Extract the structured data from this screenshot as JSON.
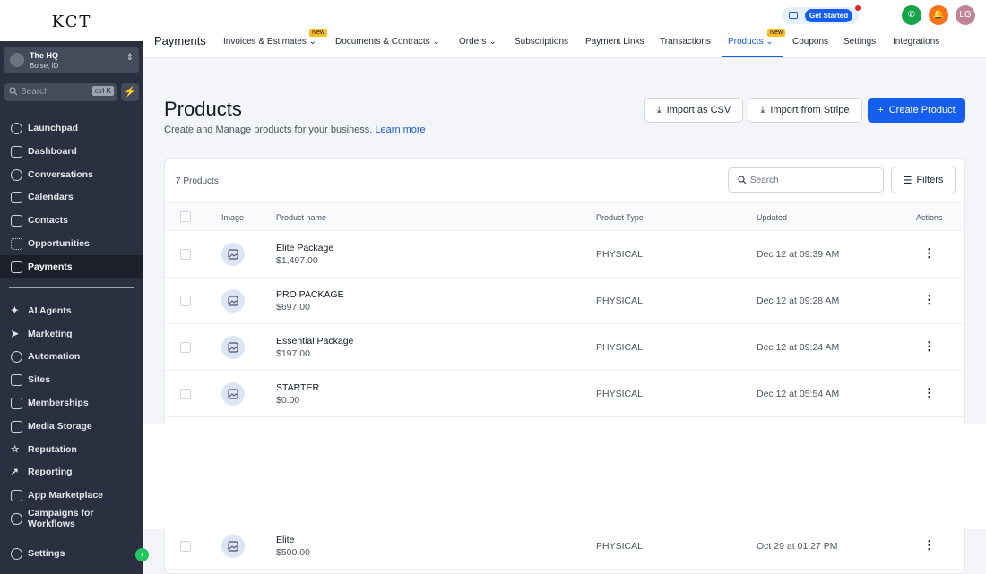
{
  "sidebar": {
    "logo": "KCT",
    "account": {
      "name": "The        HQ",
      "location": "Boise, ID"
    },
    "search": {
      "placeholder": "Search",
      "shortcut": "ctrl K"
    },
    "items": [
      {
        "label": "Launchpad",
        "icon": "rocket-icon"
      },
      {
        "label": "Dashboard",
        "icon": "grid-icon"
      },
      {
        "label": "Conversations",
        "icon": "chat-icon"
      },
      {
        "label": "Calendars",
        "icon": "calendar-icon"
      },
      {
        "label": "Contacts",
        "icon": "contacts-icon"
      },
      {
        "label": "Opportunities",
        "icon": "opportunities-icon"
      },
      {
        "label": "Payments",
        "icon": "payments-icon",
        "active": true
      },
      {
        "label": "AI Agents",
        "icon": "sparkle-icon"
      },
      {
        "label": "Marketing",
        "icon": "send-icon"
      },
      {
        "label": "Automation",
        "icon": "automation-icon"
      },
      {
        "label": "Sites",
        "icon": "sites-icon"
      },
      {
        "label": "Memberships",
        "icon": "memberships-icon"
      },
      {
        "label": "Media Storage",
        "icon": "image-icon"
      },
      {
        "label": "Reputation",
        "icon": "star-icon"
      },
      {
        "label": "Reporting",
        "icon": "chart-icon"
      },
      {
        "label": "App Marketplace",
        "icon": "apps-icon"
      },
      {
        "label": "Campaigns for Workflows",
        "icon": "mic-icon"
      },
      {
        "label": "Settings",
        "icon": "gear-icon"
      }
    ]
  },
  "topbar": {
    "section": "Payments",
    "tabs": [
      {
        "label": "Invoices & Estimates",
        "dropdown": true,
        "badge": "New"
      },
      {
        "label": "Documents & Contracts",
        "dropdown": true
      },
      {
        "label": "Orders",
        "dropdown": true
      },
      {
        "label": "Subscriptions"
      },
      {
        "label": "Payment Links"
      },
      {
        "label": "Transactions"
      },
      {
        "label": "Products",
        "dropdown": true,
        "badge": "New",
        "active": true
      },
      {
        "label": "Coupons"
      },
      {
        "label": "Settings"
      },
      {
        "label": "Integrations"
      }
    ],
    "get_started": "Get Started",
    "user_initials": "LG"
  },
  "page": {
    "title": "Products",
    "subtitle": "Create and Manage products for your business.",
    "learn_more": "Learn more",
    "import_csv": "Import as CSV",
    "import_stripe": "Import from Stripe",
    "create_product": "Create Product"
  },
  "table": {
    "count_label": "7 Products",
    "search_placeholder": "Search",
    "filters_label": "Filters",
    "columns": [
      "Image",
      "Product name",
      "Product Type",
      "Updated",
      "Actions"
    ],
    "rows": [
      {
        "name": "Elite Package",
        "price": "$1,497.00",
        "type": "PHYSICAL",
        "updated": "Dec 12 at 09:39 AM"
      },
      {
        "name": "PRO PACKAGE",
        "price": "$697.00",
        "type": "PHYSICAL",
        "updated": "Dec 12 at 09:28 AM"
      },
      {
        "name": "Essential Package",
        "price": "$197.00",
        "type": "PHYSICAL",
        "updated": "Dec 12 at 09:24 AM"
      },
      {
        "name": "STARTER",
        "price": "$0.00",
        "type": "PHYSICAL",
        "updated": "Dec 12 at 05:54 AM"
      },
      {
        "name": "Elite",
        "price": "$500.00",
        "type": "PHYSICAL",
        "updated": "Oct 29 at 01:27 PM"
      }
    ]
  },
  "colors": {
    "accent": "#155eef",
    "sidebar": "#2a3040",
    "new_badge": "#fbbf24"
  }
}
